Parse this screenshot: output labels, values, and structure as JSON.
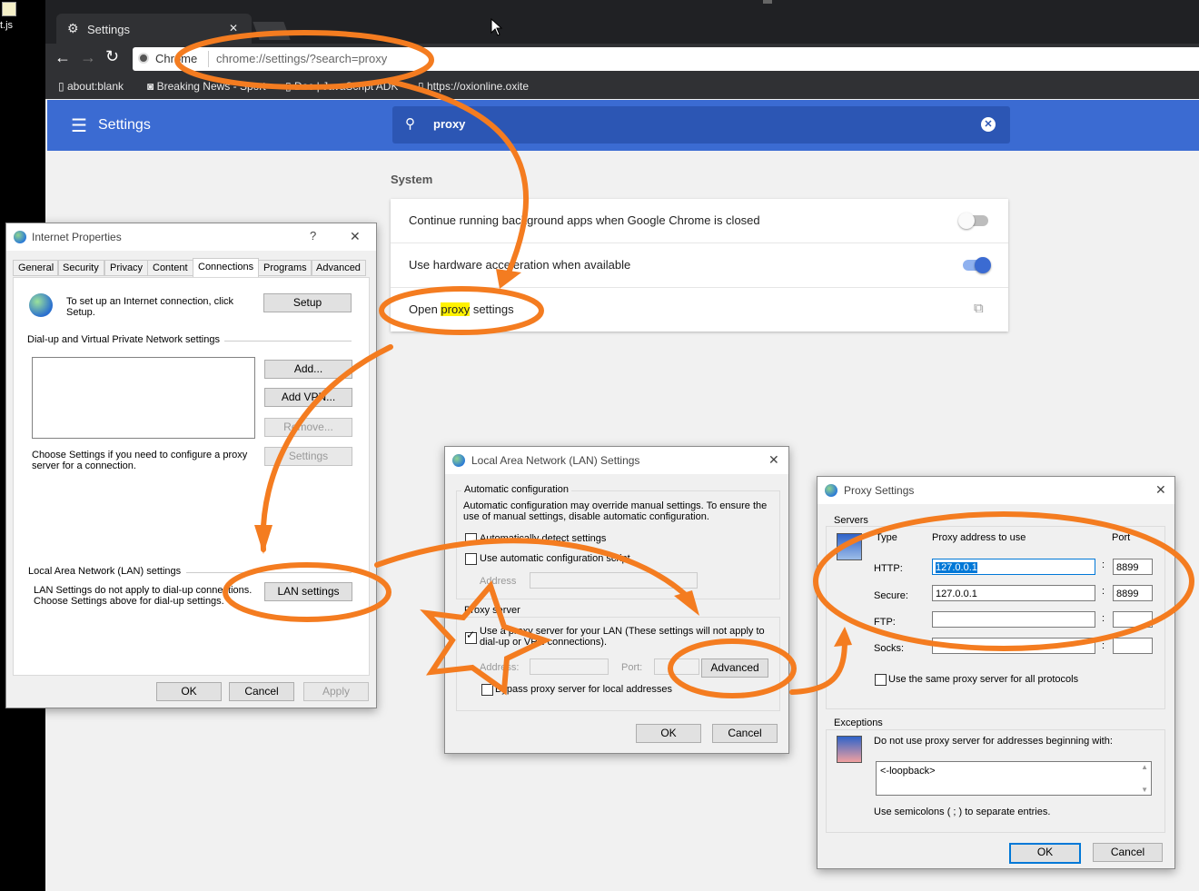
{
  "desktop": {
    "left_label": "t.js"
  },
  "browser": {
    "tab_title": "Settings",
    "omnibox_origin": "Chrome",
    "omnibox_url": "chrome://settings/?search=proxy",
    "bookmarks": [
      "about:blank",
      "Breaking News - Sport",
      "Doc | JavaScript ADK",
      "https://oxionline.oxite"
    ],
    "app_title": "Settings",
    "search_query": "proxy",
    "section_title": "System",
    "rows": [
      {
        "label": "Continue running background apps when Google Chrome is closed",
        "toggle": "off"
      },
      {
        "label": "Use hardware acceleration when available",
        "toggle": "on"
      }
    ],
    "proxy_row": {
      "before": "Open ",
      "highlight": "proxy",
      "after": " settings"
    },
    "accent_color": "#3b6bd2",
    "highlight_color": "#fff200",
    "annotation_color": "#f47c20"
  },
  "internet_properties": {
    "title": "Internet Properties",
    "help": "?",
    "close": "✕",
    "tabs": [
      "General",
      "Security",
      "Privacy",
      "Content",
      "Connections",
      "Programs",
      "Advanced"
    ],
    "active_tab": "Connections",
    "setup_text": "To set up an Internet connection, click Setup.",
    "setup_button": "Setup",
    "dialup_group": "Dial-up and Virtual Private Network settings",
    "add_button": "Add...",
    "add_vpn_button": "Add VPN...",
    "remove_button": "Remove...",
    "settings_button": "Settings",
    "proxy_hint": "Choose Settings if you need to configure a proxy server for a connection.",
    "lan_group": "Local Area Network (LAN) settings",
    "lan_text": "LAN Settings do not apply to dial-up connections. Choose Settings above for dial-up settings.",
    "lan_button": "LAN settings",
    "ok": "OK",
    "cancel": "Cancel",
    "apply": "Apply"
  },
  "lan_settings": {
    "title": "Local Area Network (LAN) Settings",
    "close": "✕",
    "auto_group": "Automatic configuration",
    "auto_desc": "Automatic configuration may override manual settings. To ensure the use of manual settings, disable automatic configuration.",
    "auto_detect": "Automatically detect settings",
    "auto_script": "Use automatic configuration script",
    "address_label": "Address",
    "proxy_group": "Proxy server",
    "use_proxy": "Use a proxy server for your LAN (These settings will not apply to dial-up or VPN connections).",
    "use_proxy_checked": true,
    "proxy_address_label": "Address:",
    "port_label": "Port:",
    "advanced_button": "Advanced",
    "bypass_local": "Bypass proxy server for local addresses",
    "ok": "OK",
    "cancel": "Cancel"
  },
  "proxy_settings": {
    "title": "Proxy Settings",
    "close": "✕",
    "servers_group": "Servers",
    "col_type": "Type",
    "col_address": "Proxy address to use",
    "col_port": "Port",
    "rows": [
      {
        "type": "HTTP:",
        "address": "127.0.0.1",
        "port": "8899"
      },
      {
        "type": "Secure:",
        "address": "127.0.0.1",
        "port": "8899"
      },
      {
        "type": "FTP:",
        "address": "",
        "port": ""
      },
      {
        "type": "Socks:",
        "address": "",
        "port": ""
      }
    ],
    "same_proxy": "Use the same proxy server for all protocols",
    "exceptions_group": "Exceptions",
    "exceptions_label": "Do not use proxy server for addresses beginning with:",
    "exceptions_value": "<-loopback>",
    "semicolon_hint": "Use semicolons ( ; ) to separate entries.",
    "ok": "OK",
    "cancel": "Cancel"
  }
}
